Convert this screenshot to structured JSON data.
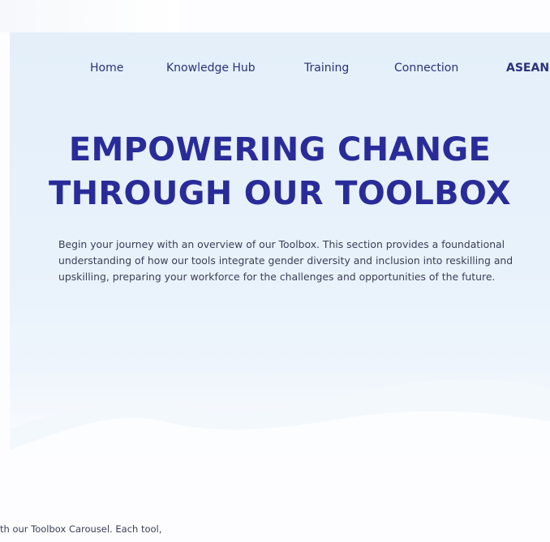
{
  "nav": {
    "items": [
      {
        "label": "Home"
      },
      {
        "label": "Knowledge Hub"
      },
      {
        "label": "Training"
      },
      {
        "label": "Connection"
      },
      {
        "label": "ASEAN"
      }
    ]
  },
  "hero": {
    "title_line1": "EMPOWERING CHANGE",
    "title_line2": "THROUGH OUR TOOLBOX",
    "intro": "Begin your journey with an overview of our Toolbox. This section provides a foundational understanding of how our tools integrate gender diversity and inclusion into reskilling and upskilling, preparing your workforce for the challenges and opportunities of the future."
  },
  "carousel_intro": {
    "text": "th our Toolbox Carousel. Each tool,"
  },
  "colors": {
    "accent": "#292c98",
    "nav_text": "#2b3277",
    "body_text": "#3a3f57",
    "hero_bg": "#e6f0fa"
  }
}
